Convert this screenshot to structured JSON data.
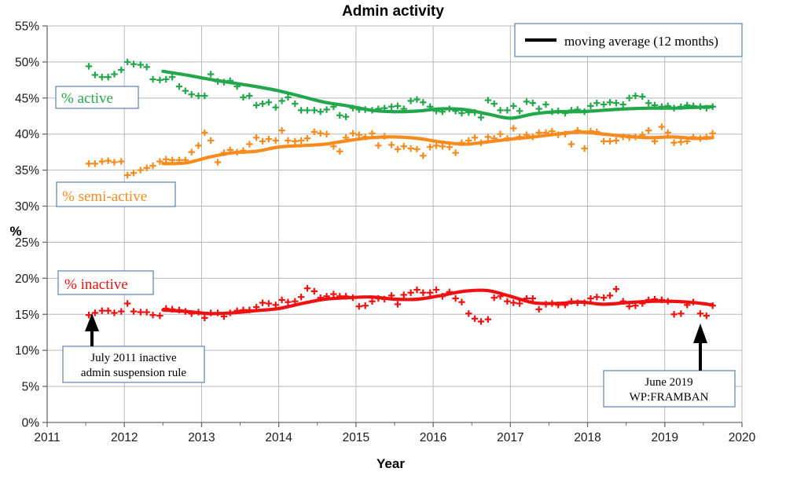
{
  "chart_data": {
    "type": "scatter",
    "title": "Admin activity",
    "xlabel": "Year",
    "ylabel": "%",
    "xlim": [
      2011,
      2020
    ],
    "ylim": [
      0,
      55
    ],
    "grid": true,
    "x_ticks": [
      "2011",
      "2012",
      "2013",
      "2014",
      "2015",
      "2016",
      "2017",
      "2018",
      "2019",
      "2020"
    ],
    "y_ticks": [
      "0%",
      "5%",
      "10%",
      "15%",
      "20%",
      "25%",
      "30%",
      "35%",
      "40%",
      "45%",
      "50%",
      "55%"
    ],
    "legend": {
      "position": "top-right",
      "entries": [
        {
          "label": "moving average (12 months)",
          "marker": "line",
          "color": "#000000"
        }
      ]
    },
    "series": [
      {
        "name": "% active",
        "color": "#22a74b",
        "marker": "plus",
        "x": [
          2011.54,
          2011.62,
          2011.71,
          2011.79,
          2011.87,
          2011.96,
          2012.04,
          2012.12,
          2012.21,
          2012.29,
          2012.37,
          2012.46,
          2012.54,
          2012.62,
          2012.71,
          2012.79,
          2012.87,
          2012.96,
          2013.04,
          2013.12,
          2013.21,
          2013.29,
          2013.37,
          2013.46,
          2013.54,
          2013.62,
          2013.71,
          2013.79,
          2013.87,
          2013.96,
          2014.04,
          2014.12,
          2014.21,
          2014.29,
          2014.37,
          2014.46,
          2014.54,
          2014.62,
          2014.71,
          2014.79,
          2014.87,
          2014.96,
          2015.04,
          2015.12,
          2015.21,
          2015.29,
          2015.37,
          2015.46,
          2015.54,
          2015.62,
          2015.71,
          2015.79,
          2015.87,
          2015.96,
          2016.04,
          2016.12,
          2016.21,
          2016.29,
          2016.37,
          2016.46,
          2016.54,
          2016.62,
          2016.71,
          2016.79,
          2016.87,
          2016.96,
          2017.04,
          2017.12,
          2017.21,
          2017.29,
          2017.37,
          2017.46,
          2017.54,
          2017.62,
          2017.71,
          2017.79,
          2017.87,
          2017.96,
          2018.04,
          2018.12,
          2018.21,
          2018.29,
          2018.37,
          2018.46,
          2018.54,
          2018.62,
          2018.71,
          2018.79,
          2018.87,
          2018.96,
          2019.04,
          2019.12,
          2019.21,
          2019.29,
          2019.37,
          2019.46,
          2019.54,
          2019.62
        ],
        "y": [
          49.4,
          48.2,
          47.9,
          47.9,
          48.3,
          48.9,
          50.0,
          49.7,
          49.6,
          49.3,
          47.6,
          47.5,
          47.6,
          47.9,
          46.6,
          46.0,
          45.5,
          45.3,
          45.3,
          48.3,
          47.3,
          47.2,
          47.4,
          46.6,
          45.1,
          45.3,
          44.0,
          44.2,
          44.4,
          43.7,
          44.6,
          45.1,
          44.2,
          43.3,
          43.3,
          43.3,
          43.1,
          43.4,
          43.8,
          42.6,
          42.4,
          43.6,
          43.4,
          43.4,
          43.3,
          43.5,
          43.6,
          43.8,
          43.9,
          43.5,
          44.6,
          44.8,
          44.4,
          43.8,
          43.2,
          43.1,
          43.5,
          43.2,
          42.9,
          43.0,
          43.0,
          42.3,
          44.7,
          44.2,
          43.3,
          43.3,
          43.9,
          43.2,
          44.5,
          44.3,
          43.5,
          44.1,
          43.1,
          43.2,
          42.9,
          43.3,
          43.4,
          43.1,
          43.9,
          44.3,
          44.1,
          44.4,
          44.3,
          44.1,
          45.0,
          45.3,
          45.2,
          44.3,
          44.0,
          43.8,
          43.9,
          43.6,
          43.8,
          44.0,
          43.9,
          43.8,
          43.6,
          43.8
        ],
        "trend_x": [
          2012.5,
          2012.8,
          2013.1,
          2013.4,
          2013.7,
          2014.0,
          2014.3,
          2014.6,
          2014.9,
          2015.2,
          2015.5,
          2015.8,
          2016.1,
          2016.4,
          2016.7,
          2017.0,
          2017.3,
          2017.6,
          2017.9,
          2018.2,
          2018.5,
          2018.8,
          2019.1,
          2019.4,
          2019.62
        ],
        "trend_y": [
          48.7,
          48.2,
          47.6,
          47.1,
          46.6,
          46.0,
          45.2,
          44.4,
          43.9,
          43.3,
          43.1,
          43.2,
          43.5,
          43.4,
          42.8,
          42.2,
          42.8,
          43.1,
          43.1,
          43.3,
          43.5,
          43.6,
          43.6,
          43.7,
          43.8
        ]
      },
      {
        "name": "% semi-active",
        "color": "#f78b1e",
        "marker": "plus",
        "x": [
          2011.54,
          2011.62,
          2011.71,
          2011.79,
          2011.87,
          2011.96,
          2012.04,
          2012.12,
          2012.21,
          2012.29,
          2012.37,
          2012.46,
          2012.54,
          2012.62,
          2012.71,
          2012.79,
          2012.87,
          2012.96,
          2013.04,
          2013.12,
          2013.21,
          2013.29,
          2013.37,
          2013.46,
          2013.54,
          2013.62,
          2013.71,
          2013.79,
          2013.87,
          2013.96,
          2014.04,
          2014.12,
          2014.21,
          2014.29,
          2014.37,
          2014.46,
          2014.54,
          2014.62,
          2014.71,
          2014.79,
          2014.87,
          2014.96,
          2015.04,
          2015.12,
          2015.21,
          2015.29,
          2015.37,
          2015.46,
          2015.54,
          2015.62,
          2015.71,
          2015.79,
          2015.87,
          2015.96,
          2016.04,
          2016.12,
          2016.21,
          2016.29,
          2016.37,
          2016.46,
          2016.54,
          2016.62,
          2016.71,
          2016.79,
          2016.87,
          2016.96,
          2017.04,
          2017.12,
          2017.21,
          2017.29,
          2017.37,
          2017.46,
          2017.54,
          2017.62,
          2017.71,
          2017.79,
          2017.87,
          2017.96,
          2018.04,
          2018.12,
          2018.21,
          2018.29,
          2018.37,
          2018.46,
          2018.54,
          2018.62,
          2018.71,
          2018.79,
          2018.87,
          2018.96,
          2019.04,
          2019.12,
          2019.21,
          2019.29,
          2019.37,
          2019.46,
          2019.54,
          2019.62
        ],
        "y": [
          35.9,
          35.9,
          36.2,
          36.3,
          36.1,
          36.2,
          34.3,
          34.6,
          35.0,
          35.3,
          35.6,
          36.2,
          36.5,
          36.4,
          36.4,
          36.4,
          37.5,
          38.4,
          40.2,
          39.1,
          36.1,
          37.4,
          37.8,
          37.5,
          37.7,
          38.6,
          39.5,
          39.0,
          39.3,
          39.1,
          40.5,
          39.1,
          39.0,
          39.1,
          39.4,
          40.3,
          40.1,
          40.0,
          38.3,
          37.6,
          39.5,
          40.1,
          39.9,
          39.6,
          40.1,
          38.4,
          39.7,
          38.5,
          37.9,
          38.3,
          38.0,
          37.9,
          37.0,
          38.2,
          38.4,
          38.3,
          38.2,
          37.4,
          38.8,
          39.1,
          39.5,
          38.8,
          39.6,
          39.4,
          40.0,
          39.4,
          40.8,
          39.6,
          39.9,
          39.6,
          40.2,
          40.2,
          40.4,
          39.9,
          40.0,
          38.6,
          40.5,
          38.0,
          40.4,
          40.3,
          39.0,
          39.0,
          39.1,
          39.6,
          39.5,
          39.6,
          39.9,
          40.5,
          39.0,
          41.0,
          40.2,
          38.8,
          38.9,
          39.0,
          39.6,
          39.4,
          39.6,
          40.1
        ],
        "trend_x": [
          2012.5,
          2012.8,
          2013.1,
          2013.4,
          2013.7,
          2014.0,
          2014.3,
          2014.6,
          2014.9,
          2015.2,
          2015.5,
          2015.8,
          2016.1,
          2016.4,
          2016.7,
          2017.0,
          2017.3,
          2017.6,
          2017.9,
          2018.2,
          2018.5,
          2018.8,
          2019.1,
          2019.4,
          2019.62
        ],
        "trend_y": [
          35.9,
          36.0,
          36.8,
          37.4,
          37.6,
          38.2,
          38.4,
          38.6,
          39.1,
          39.5,
          39.6,
          39.4,
          38.9,
          38.6,
          38.9,
          39.3,
          39.6,
          40.0,
          40.3,
          40.0,
          39.7,
          39.5,
          39.6,
          39.4,
          39.5
        ]
      },
      {
        "name": "% inactive",
        "color": "#ef1111",
        "marker": "plus",
        "x": [
          2011.54,
          2011.62,
          2011.71,
          2011.79,
          2011.87,
          2011.96,
          2012.04,
          2012.12,
          2012.21,
          2012.29,
          2012.37,
          2012.46,
          2012.54,
          2012.62,
          2012.71,
          2012.79,
          2012.87,
          2012.96,
          2013.04,
          2013.12,
          2013.21,
          2013.29,
          2013.37,
          2013.46,
          2013.54,
          2013.62,
          2013.71,
          2013.79,
          2013.87,
          2013.96,
          2014.04,
          2014.12,
          2014.21,
          2014.29,
          2014.37,
          2014.46,
          2014.54,
          2014.62,
          2014.71,
          2014.79,
          2014.87,
          2014.96,
          2015.04,
          2015.12,
          2015.21,
          2015.29,
          2015.37,
          2015.46,
          2015.54,
          2015.62,
          2015.71,
          2015.79,
          2015.87,
          2015.96,
          2016.04,
          2016.12,
          2016.21,
          2016.29,
          2016.37,
          2016.46,
          2016.54,
          2016.62,
          2016.71,
          2016.79,
          2016.87,
          2016.96,
          2017.04,
          2017.12,
          2017.21,
          2017.29,
          2017.37,
          2017.46,
          2017.54,
          2017.62,
          2017.71,
          2017.79,
          2017.87,
          2017.96,
          2018.04,
          2018.12,
          2018.21,
          2018.29,
          2018.37,
          2018.46,
          2018.54,
          2018.62,
          2018.71,
          2018.79,
          2018.87,
          2018.96,
          2019.04,
          2019.12,
          2019.21,
          2019.29,
          2019.37,
          2019.46,
          2019.54,
          2019.62
        ],
        "y": [
          14.9,
          15.2,
          15.5,
          15.5,
          15.2,
          15.4,
          16.5,
          15.4,
          15.3,
          15.3,
          14.9,
          14.8,
          15.8,
          15.7,
          15.6,
          15.4,
          15.1,
          15.3,
          14.5,
          15.2,
          15.2,
          14.7,
          15.2,
          15.5,
          15.6,
          15.6,
          16.0,
          16.6,
          16.5,
          16.3,
          17.0,
          16.7,
          16.8,
          17.4,
          18.6,
          18.2,
          17.3,
          17.5,
          17.8,
          17.5,
          17.5,
          17.3,
          16.1,
          16.2,
          16.8,
          17.2,
          17.1,
          17.6,
          16.4,
          17.7,
          18.0,
          18.4,
          18.0,
          18.0,
          18.4,
          17.5,
          18.1,
          17.2,
          16.7,
          15.1,
          14.4,
          14.0,
          14.3,
          17.3,
          17.5,
          16.8,
          16.6,
          16.5,
          17.2,
          17.2,
          15.7,
          16.4,
          16.5,
          16.3,
          16.3,
          16.8,
          16.6,
          16.6,
          17.2,
          17.4,
          17.3,
          17.6,
          18.5,
          16.8,
          16.1,
          16.2,
          16.5,
          17.0,
          17.1,
          17.0,
          16.8,
          15.0,
          15.1,
          16.3,
          16.7,
          15.1,
          14.8,
          16.2
        ],
        "trend_x": [
          2012.5,
          2012.8,
          2013.1,
          2013.4,
          2013.7,
          2014.0,
          2014.3,
          2014.6,
          2014.9,
          2015.2,
          2015.5,
          2015.8,
          2016.1,
          2016.4,
          2016.7,
          2017.0,
          2017.3,
          2017.6,
          2017.9,
          2018.2,
          2018.5,
          2018.8,
          2019.1,
          2019.4,
          2019.62
        ],
        "trend_y": [
          15.6,
          15.4,
          15.1,
          15.2,
          15.5,
          15.8,
          16.5,
          17.1,
          17.3,
          17.4,
          17.1,
          17.1,
          17.6,
          18.2,
          18.3,
          17.5,
          16.6,
          16.5,
          16.7,
          16.4,
          16.6,
          16.8,
          16.8,
          16.6,
          16.3
        ]
      }
    ],
    "annotations": [
      {
        "id": "july-2011",
        "line1": "July 2011 inactive",
        "line2": "admin suspension rule",
        "x": 2011.54,
        "y": 15.0
      },
      {
        "id": "june-2019",
        "line1": "June 2019",
        "line2": "WP:FRAMBAN",
        "x": 2019.45,
        "y": 14.5
      }
    ],
    "series_labels": [
      {
        "id": "active",
        "text": "% active",
        "color": "#22a74b"
      },
      {
        "id": "semi-active",
        "text": "% semi-active",
        "color": "#f78b1e"
      },
      {
        "id": "inactive",
        "text": "% inactive",
        "color": "#ef1111"
      }
    ],
    "colors": {
      "active": "#22a74b",
      "semi_active": "#f78b1e",
      "inactive": "#ef1111",
      "grid": "#b8b8b8",
      "axis": "#6a6a6a",
      "box_border": "#5b82b0",
      "text": "#000000"
    }
  }
}
